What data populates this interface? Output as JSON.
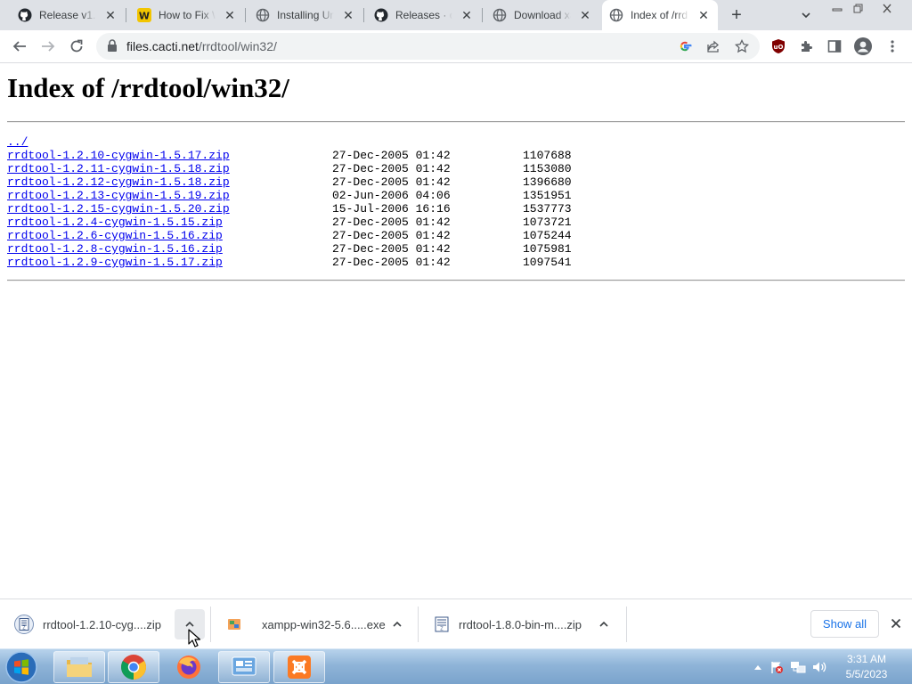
{
  "browser": {
    "tabs": [
      {
        "title": "Release v1.1",
        "icon": "github-icon"
      },
      {
        "title": "How to Fix W",
        "icon": "wikihow-icon"
      },
      {
        "title": "Installing Un",
        "icon": "globe-icon"
      },
      {
        "title": "Releases · oe",
        "icon": "github-icon"
      },
      {
        "title": "Download xa",
        "icon": "globe-icon"
      },
      {
        "title": "Index of /rrd",
        "icon": "globe-icon",
        "active": true
      }
    ],
    "address": {
      "domain": "files.cacti.net",
      "path": "/rrdtool/win32/"
    }
  },
  "page": {
    "heading": "Index of /rrdtool/win32/",
    "parent_link": "../",
    "files": [
      {
        "name": "rrdtool-1.2.10-cygwin-1.5.17.zip",
        "date": "27-Dec-2005 01:42",
        "size": "1107688"
      },
      {
        "name": "rrdtool-1.2.11-cygwin-1.5.18.zip",
        "date": "27-Dec-2005 01:42",
        "size": "1153080"
      },
      {
        "name": "rrdtool-1.2.12-cygwin-1.5.18.zip",
        "date": "27-Dec-2005 01:42",
        "size": "1396680"
      },
      {
        "name": "rrdtool-1.2.13-cygwin-1.5.19.zip",
        "date": "02-Jun-2006 04:06",
        "size": "1351951"
      },
      {
        "name": "rrdtool-1.2.15-cygwin-1.5.20.zip",
        "date": "15-Jul-2006 16:16",
        "size": "1537773"
      },
      {
        "name": "rrdtool-1.2.4-cygwin-1.5.15.zip",
        "date": "27-Dec-2005 01:42",
        "size": "1073721"
      },
      {
        "name": "rrdtool-1.2.6-cygwin-1.5.16.zip",
        "date": "27-Dec-2005 01:42",
        "size": "1075244"
      },
      {
        "name": "rrdtool-1.2.8-cygwin-1.5.16.zip",
        "date": "27-Dec-2005 01:42",
        "size": "1075981"
      },
      {
        "name": "rrdtool-1.2.9-cygwin-1.5.17.zip",
        "date": "27-Dec-2005 01:42",
        "size": "1097541"
      }
    ]
  },
  "downloads": {
    "items": [
      {
        "name": "rrdtool-1.2.10-cyg....zip",
        "icon": "zip-file-icon"
      },
      {
        "name": "xampp-win32-5.6.....exe",
        "icon": "exe-file-icon"
      },
      {
        "name": "rrdtool-1.8.0-bin-m....zip",
        "icon": "zip-file-icon"
      }
    ],
    "show_all": "Show all"
  },
  "taskbar": {
    "time": "3:31 AM",
    "date": "5/5/2023"
  }
}
